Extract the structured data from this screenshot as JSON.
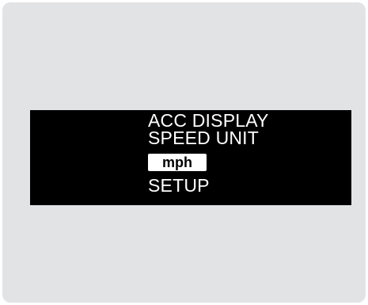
{
  "display": {
    "line1": "ACC DISPLAY",
    "line2": "SPEED UNIT",
    "selected_unit": "mph",
    "line4": "SETUP"
  },
  "colors": {
    "background": "#e2e3e5",
    "screen": "#000000",
    "text": "#ffffff",
    "highlight": "#ffffff"
  }
}
